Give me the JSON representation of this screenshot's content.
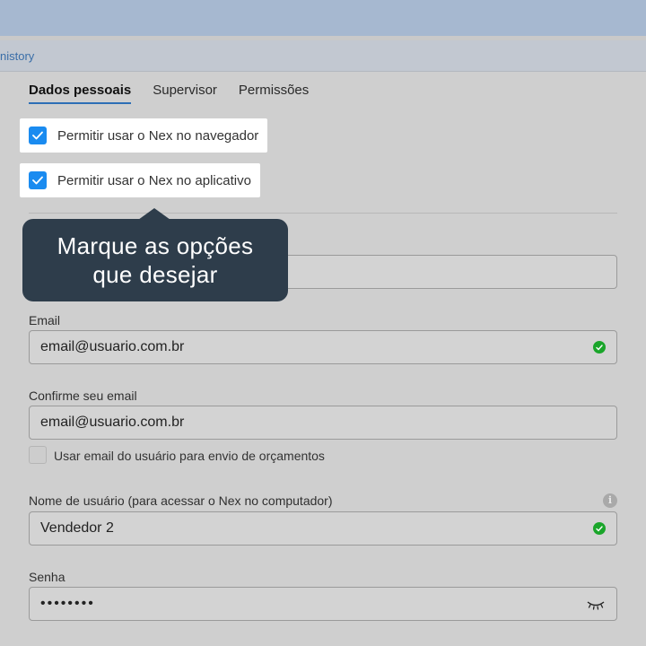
{
  "history": {
    "link": "nistory"
  },
  "tabs": [
    {
      "label": "Dados pessoais",
      "active": true
    },
    {
      "label": "Supervisor",
      "active": false
    },
    {
      "label": "Permissões",
      "active": false
    }
  ],
  "permissions": [
    {
      "label": "Permitir usar o Nex no navegador",
      "checked": true
    },
    {
      "label": "Permitir usar o Nex no aplicativo",
      "checked": true
    }
  ],
  "tooltip": {
    "line1": "Marque as opções",
    "line2": "que desejar"
  },
  "form": {
    "email": {
      "label": "Email",
      "value": "email@usuario.com.br",
      "valid": true
    },
    "confirm_email": {
      "label": "Confirme seu email",
      "value": "email@usuario.com.br"
    },
    "use_email_checkbox": {
      "label": "Usar email do usuário para envio de orçamentos",
      "checked": false
    },
    "username": {
      "label": "Nome de usuário (para acessar o Nex no computador)",
      "value": "Vendedor 2",
      "valid": true
    },
    "password": {
      "label": "Senha",
      "value": "••••••••"
    }
  },
  "icons": {
    "check": "check-icon",
    "valid": "check-circle-icon",
    "info": "info-icon",
    "eye": "eye-closed-icon"
  },
  "colors": {
    "accent": "#1a8bf0",
    "tooltip_bg": "#2e3d4b",
    "success": "#1aa52a",
    "tab_underline": "#2d6fb6"
  }
}
